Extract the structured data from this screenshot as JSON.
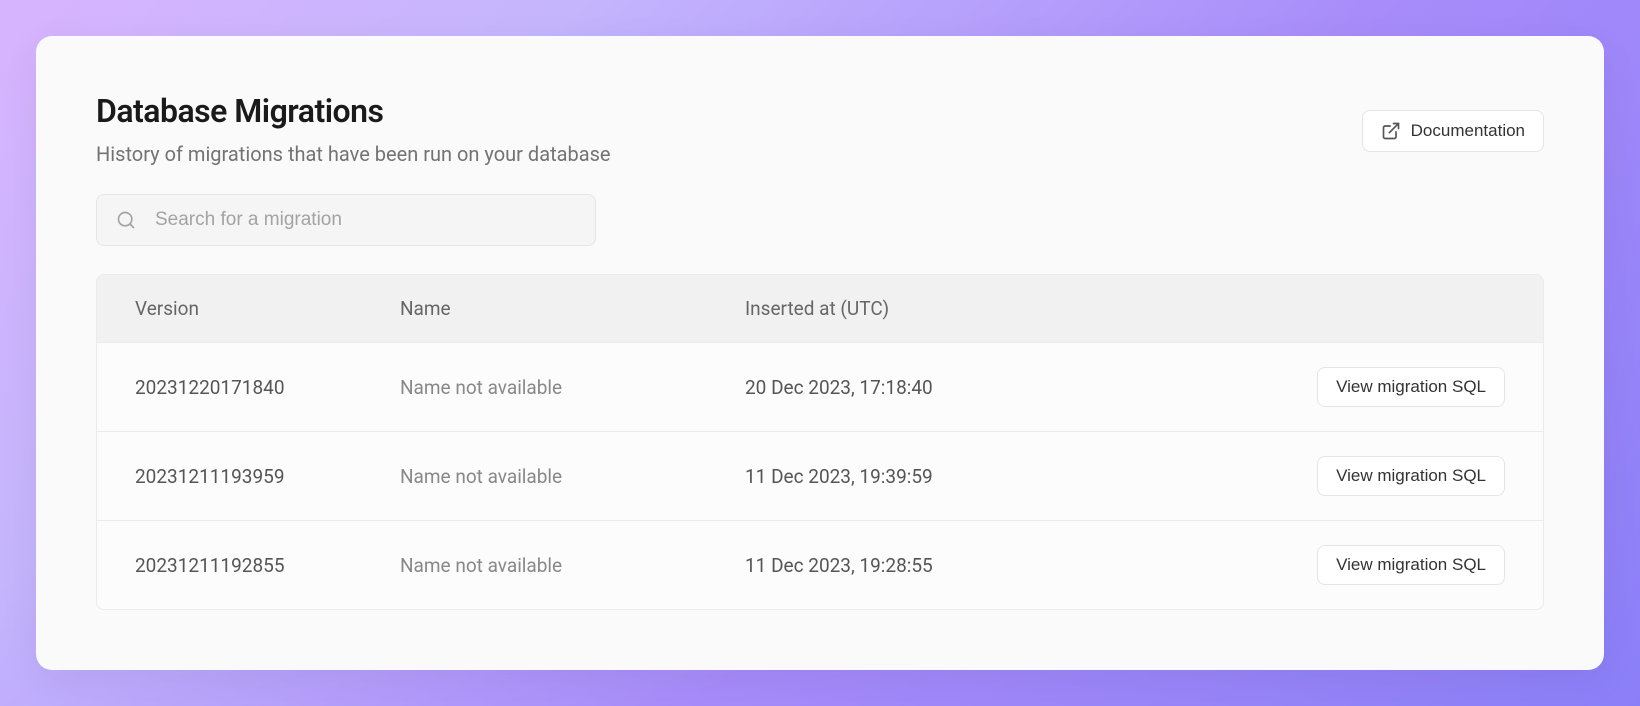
{
  "header": {
    "title": "Database Migrations",
    "subtitle": "History of migrations that have been run on your database",
    "doc_label": "Documentation"
  },
  "search": {
    "placeholder": "Search for a migration",
    "value": ""
  },
  "table": {
    "columns": {
      "version": "Version",
      "name": "Name",
      "inserted_at": "Inserted at (UTC)"
    },
    "action_label": "View migration SQL",
    "rows": [
      {
        "version": "20231220171840",
        "name": "Name not available",
        "inserted_at": "20 Dec 2023, 17:18:40"
      },
      {
        "version": "20231211193959",
        "name": "Name not available",
        "inserted_at": "11 Dec 2023, 19:39:59"
      },
      {
        "version": "20231211192855",
        "name": "Name not available",
        "inserted_at": "11 Dec 2023, 19:28:55"
      }
    ]
  }
}
